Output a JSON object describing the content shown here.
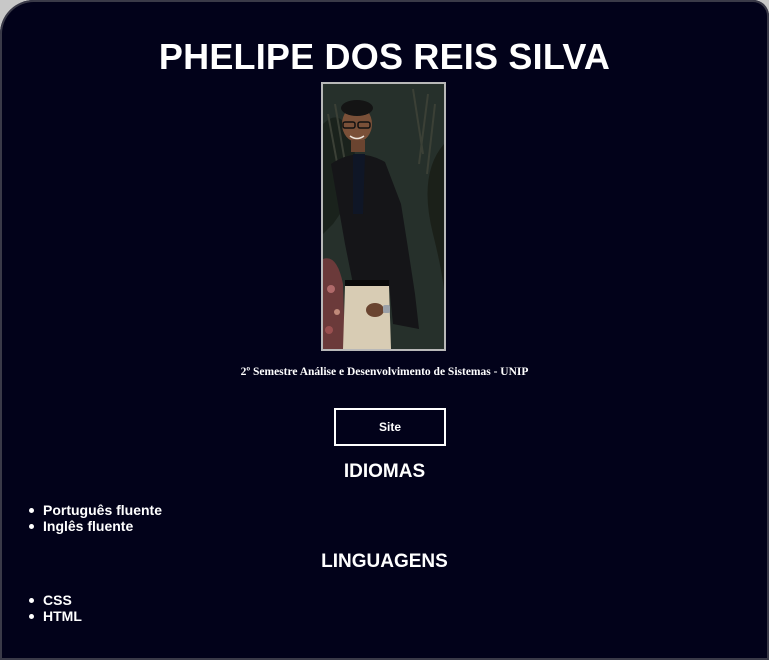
{
  "header": {
    "name": "PHELIPE DOS REIS SILVA"
  },
  "profile": {
    "photo_icon": "person-photo",
    "course": "2º Semestre Análise e Desenvolvimento de Sistemas - UNIP"
  },
  "buttons": {
    "site_label": "Site"
  },
  "idiomas": {
    "title": "IDIOMAS",
    "items": [
      "Português fluente",
      "Inglês fluente"
    ]
  },
  "linguagens": {
    "title": "LINGUAGENS",
    "items": [
      "CSS",
      "HTML"
    ]
  },
  "colors": {
    "background": "#02021a",
    "text": "#ffffff"
  }
}
